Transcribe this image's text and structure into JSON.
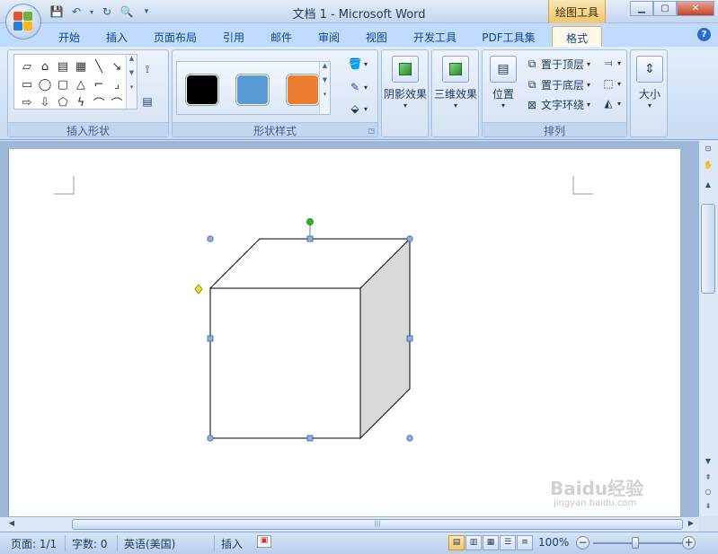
{
  "window": {
    "title": "文档 1 - Microsoft Word",
    "context_tab": "绘图工具",
    "buttons": [
      "minimize",
      "maximize",
      "close"
    ]
  },
  "quick_access": [
    "save-icon",
    "undo-icon",
    "redo-icon",
    "print-preview-icon",
    "customize-icon"
  ],
  "tabs": [
    {
      "label": "开始",
      "active": false
    },
    {
      "label": "插入",
      "active": false
    },
    {
      "label": "页面布局",
      "active": false
    },
    {
      "label": "引用",
      "active": false
    },
    {
      "label": "邮件",
      "active": false
    },
    {
      "label": "审阅",
      "active": false
    },
    {
      "label": "视图",
      "active": false
    },
    {
      "label": "开发工具",
      "active": false
    },
    {
      "label": "PDF工具集",
      "active": false
    },
    {
      "label": "格式",
      "active": true
    }
  ],
  "ribbon": {
    "groups": {
      "insert_shapes": "插入形状",
      "shape_styles": "形状样式",
      "shadow": "阴影效果",
      "three_d": "三维效果",
      "arrange": "排列",
      "size": "大小"
    },
    "swatch_colors": [
      "#000000",
      "#5b9bd5",
      "#ed7d31"
    ],
    "arrange": {
      "position": "位置",
      "bring_to_front": "置于顶层",
      "send_to_back": "置于底层",
      "text_wrap": "文字环绕"
    },
    "shape_glyphs": [
      "▱",
      "⌂",
      "▤",
      "▦",
      "╲",
      "↘",
      "▭",
      "◯",
      "▢",
      "△",
      "⌐",
      "⌟",
      "⇨",
      "⇩",
      "⬠",
      "ϟ",
      "⌒",
      "⌒"
    ]
  },
  "document": {
    "shape": "cube",
    "colors": {
      "front": "#ffffff",
      "side": "#d9d9d9",
      "top": "#ffffff",
      "stroke": "#000000",
      "handle": "#4f81bd",
      "rotate": "#2bb52b",
      "adjust": "#f2e22c"
    }
  },
  "status": {
    "page": "页面: 1/1",
    "words": "字数: 0",
    "language": "英语(美国)",
    "mode": "插入",
    "zoom": "100%",
    "zoom_minus": "−",
    "zoom_plus": "+"
  },
  "watermark": {
    "text": "Baidu经验",
    "sub": "jingyan.baidu.com"
  }
}
